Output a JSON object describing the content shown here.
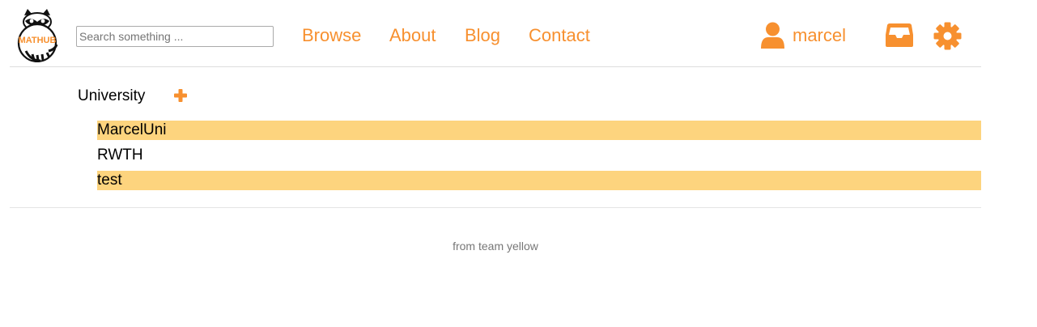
{
  "header": {
    "logo_text": "MATHUB",
    "search": {
      "placeholder": "Search something ...",
      "value": ""
    },
    "nav": [
      {
        "label": "Browse"
      },
      {
        "label": "About"
      },
      {
        "label": "Blog"
      },
      {
        "label": "Contact"
      }
    ],
    "user": {
      "name": "marcel"
    },
    "icons": [
      "raccoon-logo",
      "user-icon",
      "inbox-icon",
      "gear-icon",
      "plus-icon"
    ]
  },
  "main": {
    "section_title": "University",
    "universities": [
      {
        "name": "MarcelUni",
        "highlighted": true
      },
      {
        "name": "RWTH",
        "highlighted": false
      },
      {
        "name": "test",
        "highlighted": true
      }
    ]
  },
  "footer": {
    "text": "from team yellow"
  },
  "colors": {
    "accent": "#f7902f",
    "highlight": "#fdd47e",
    "divider": "#dddddd",
    "footer_text": "#777777"
  }
}
